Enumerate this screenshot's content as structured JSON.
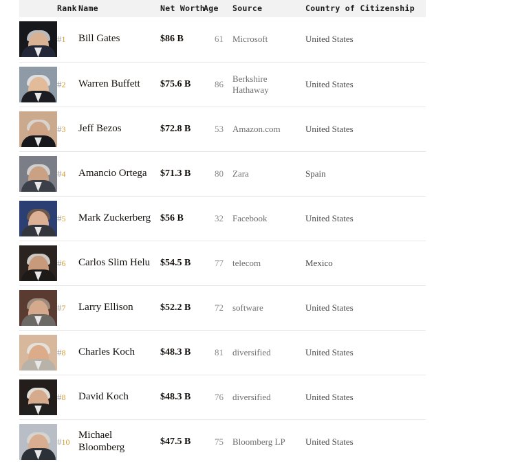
{
  "table": {
    "columns": {
      "photo": "",
      "rank": "Rank",
      "name": "Name",
      "net_worth": "Net Worth",
      "age": "Age",
      "source": "Source",
      "country": "Country of Citizenship"
    },
    "colors": {
      "header_background": "#f2f2f2",
      "rank_accent": "#d89b2a",
      "row_divider": "#e6e6e6",
      "name_text": "#14100c",
      "muted_text": "#8a8a8a",
      "page_background": "#ffffff"
    },
    "rows": [
      {
        "rank": "#1",
        "rank_hash": "#",
        "rank_num": "1",
        "name": "Bill Gates",
        "net_worth": "$86 B",
        "age": "61",
        "source": "Microsoft",
        "country": "United States",
        "photo": "portrait-bill-gates"
      },
      {
        "rank": "#2",
        "rank_hash": "#",
        "rank_num": "2",
        "name": "Warren Buffett",
        "net_worth": "$75.6 B",
        "age": "86",
        "source": "Berkshire Hathaway",
        "country": "United States",
        "photo": "portrait-warren-buffett"
      },
      {
        "rank": "#3",
        "rank_hash": "#",
        "rank_num": "3",
        "name": "Jeff Bezos",
        "net_worth": "$72.8 B",
        "age": "53",
        "source": "Amazon.com",
        "country": "United States",
        "photo": "portrait-jeff-bezos"
      },
      {
        "rank": "#4",
        "rank_hash": "#",
        "rank_num": "4",
        "name": "Amancio Ortega",
        "net_worth": "$71.3 B",
        "age": "80",
        "source": "Zara",
        "country": "Spain",
        "photo": "portrait-amancio-ortega"
      },
      {
        "rank": "#5",
        "rank_hash": "#",
        "rank_num": "5",
        "name": "Mark Zuckerberg",
        "net_worth": "$56 B",
        "age": "32",
        "source": "Facebook",
        "country": "United States",
        "photo": "portrait-mark-zuckerberg"
      },
      {
        "rank": "#6",
        "rank_hash": "#",
        "rank_num": "6",
        "name": "Carlos Slim Helu",
        "net_worth": "$54.5 B",
        "age": "77",
        "source": "telecom",
        "country": "Mexico",
        "photo": "portrait-carlos-slim-helu"
      },
      {
        "rank": "#7",
        "rank_hash": "#",
        "rank_num": "7",
        "name": "Larry Ellison",
        "net_worth": "$52.2 B",
        "age": "72",
        "source": "software",
        "country": "United States",
        "photo": "portrait-larry-ellison"
      },
      {
        "rank": "#8",
        "rank_hash": "#",
        "rank_num": "8",
        "name": "Charles Koch",
        "net_worth": "$48.3 B",
        "age": "81",
        "source": "diversified",
        "country": "United States",
        "photo": "portrait-charles-koch"
      },
      {
        "rank": "#8",
        "rank_hash": "#",
        "rank_num": "8",
        "name": "David Koch",
        "net_worth": "$48.3 B",
        "age": "76",
        "source": "diversified",
        "country": "United States",
        "photo": "portrait-david-koch"
      },
      {
        "rank": "#10",
        "rank_hash": "#",
        "rank_num": "10",
        "name": "Michael Bloomberg",
        "net_worth": "$47.5 B",
        "age": "75",
        "source": "Bloomberg LP",
        "country": "United States",
        "photo": "portrait-michael-bloomberg"
      }
    ]
  }
}
